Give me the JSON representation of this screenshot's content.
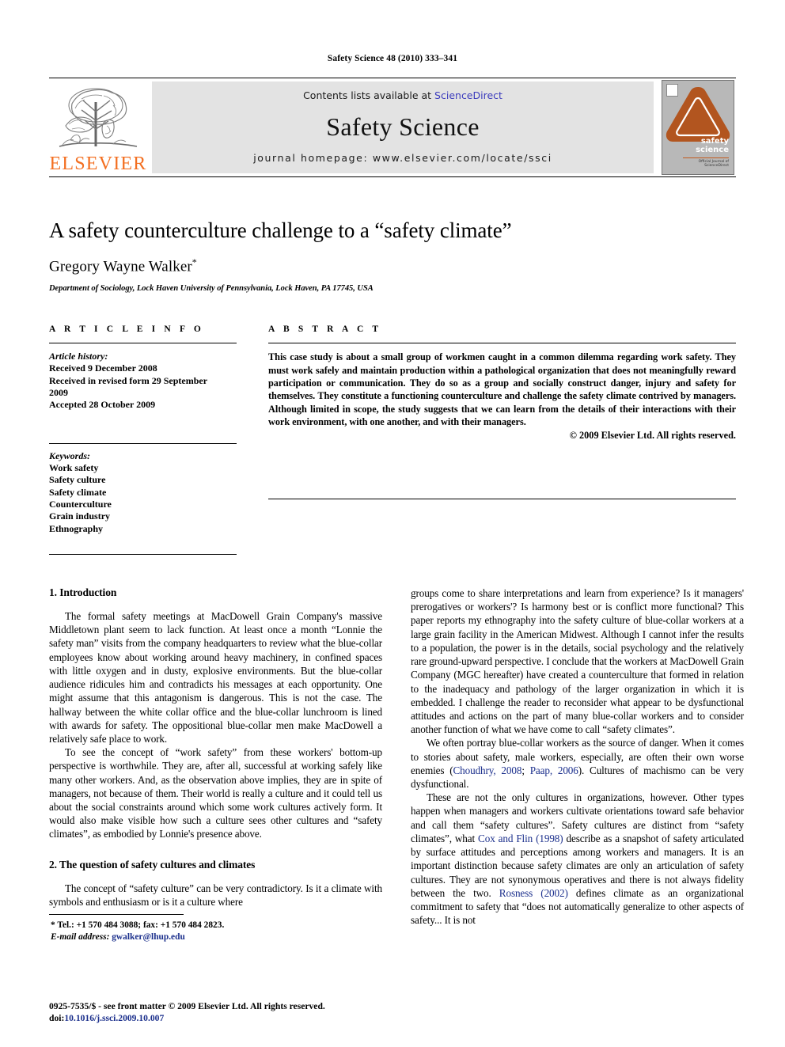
{
  "running_head": "Safety Science 48 (2010) 333–341",
  "masthead": {
    "publisher_name": "ELSEVIER",
    "publisher_logo_alt": "elsevier-tree-logo",
    "contents_prefix": "Contents lists available at ",
    "contents_link": "ScienceDirect",
    "journal_title": "Safety Science",
    "homepage": "journal homepage: www.elsevier.com/locate/ssci",
    "cover": {
      "line1": "safety",
      "line2": "science",
      "foot_line1": "Official Journal of",
      "foot_line2": "ScienceDirect",
      "accent_color": "#b2551f",
      "background_color": "#b8b8b8"
    }
  },
  "article": {
    "title": "A safety counterculture challenge to a “safety climate”",
    "author": "Gregory Wayne Walker",
    "author_marker": "*",
    "affiliation": "Department of Sociology, Lock Haven University of Pennsylvania, Lock Haven, PA 17745, USA"
  },
  "info": {
    "heading": "A R T I C L E   I N F O",
    "history_label": "Article history:",
    "history": [
      "Received 9 December 2008",
      "Received in revised form 29 September",
      "2009",
      "Accepted 28 October 2009"
    ],
    "keywords_label": "Keywords:",
    "keywords": [
      "Work safety",
      "Safety culture",
      "Safety climate",
      "Counterculture",
      "Grain industry",
      "Ethnography"
    ]
  },
  "abstract": {
    "heading": "A B S T R A C T",
    "text": "This case study is about a small group of workmen caught in a common dilemma regarding work safety. They must work safely and maintain production within a pathological organization that does not meaningfully reward participation or communication. They do so as a group and socially construct danger, injury and safety for themselves. They constitute a functioning counterculture and challenge the safety climate contrived by managers. Although limited in scope, the study suggests that we can learn from the details of their interactions with their work environment, with one another, and with their managers.",
    "copyright": "© 2009 Elsevier Ltd. All rights reserved."
  },
  "body": {
    "left_column": {
      "section1_heading": "1. Introduction",
      "section1_para1": "The formal safety meetings at MacDowell Grain Company's massive Middletown plant seem to lack function. At least once a month “Lonnie the safety man” visits from the company headquarters to review what the blue-collar employees know about working around heavy machinery, in confined spaces with little oxygen and in dusty, explosive environments. But the blue-collar audience ridicules him and contradicts his messages at each opportunity. One might assume that this antagonism is dangerous. This is not the case. The hallway between the white collar office and the blue-collar lunchroom is lined with awards for safety. The oppositional blue-collar men make MacDowell a relatively safe place to work.",
      "section1_para2": "To see the concept of “work safety” from these workers' bottom-up perspective is worthwhile. They are, after all, successful at working safely like many other workers. And, as the observation above implies, they are in spite of managers, not because of them. Their world is really a culture and it could tell us about the social constraints around which some work cultures actively form. It would also make visible how such a culture sees other cultures and “safety climates”, as embodied by Lonnie's presence above.",
      "section2_heading": "2. The question of safety cultures and climates",
      "section2_para1": "The concept of “safety culture” can be very contradictory. Is it a climate with symbols and enthusiasm or is it a culture where",
      "footnote_marker": "*",
      "footnote_tel": "Tel.: +1 570 484 3088; fax: +1 570 484 2823.",
      "footnote_email_label": "E-mail address:",
      "footnote_email": "gwalker@lhup.edu"
    },
    "right_column": {
      "para1": "groups come to share interpretations and learn from experience? Is it managers' prerogatives or workers'? Is harmony best or is conflict more functional? This paper reports my ethnography into the safety culture of blue-collar workers at a large grain facility in the American Midwest. Although I cannot infer the results to a population, the power is in the details, social psychology and the relatively rare ground-upward perspective. I conclude that the workers at MacDowell Grain Company (MGC hereafter) have created a counterculture that formed in relation to the inadequacy and pathology of the larger organization in which it is embedded. I challenge the reader to reconsider what appear to be dysfunctional attitudes and actions on the part of many blue-collar workers and to consider another function of what we have come to call “safety climates”.",
      "para2_a": "We often portray blue-collar workers as the source of danger. When it comes to stories about safety, male workers, especially, are often their own worse enemies (",
      "para2_ref1": "Choudhry, 2008",
      "para2_b": "; ",
      "para2_ref2": "Paap, 2006",
      "para2_c": "). Cultures of machismo can be very dysfunctional.",
      "para3_a": "These are not the only cultures in organizations, however. Other types happen when managers and workers cultivate orientations toward safe behavior and call them “safety cultures”. Safety cultures are distinct from “safety climates”, what ",
      "para3_ref1": "Cox and Flin (1998)",
      "para3_b": " describe as a snapshot of safety articulated by surface attitudes and perceptions among workers and managers. It is an important distinction because safety climates are only an articulation of safety cultures. They are not synonymous operatives and there is not always fidelity between the two. ",
      "para3_ref2": "Rosness (2002)",
      "para3_c": " defines climate as an organizational commitment to safety that “does not automatically generalize to other aspects of safety... It is not"
    }
  },
  "footer": {
    "issn_line": "0925-7535/$ - see front matter © 2009 Elsevier Ltd. All rights reserved.",
    "doi_prefix": "doi:",
    "doi": "10.1016/j.ssci.2009.10.007"
  }
}
